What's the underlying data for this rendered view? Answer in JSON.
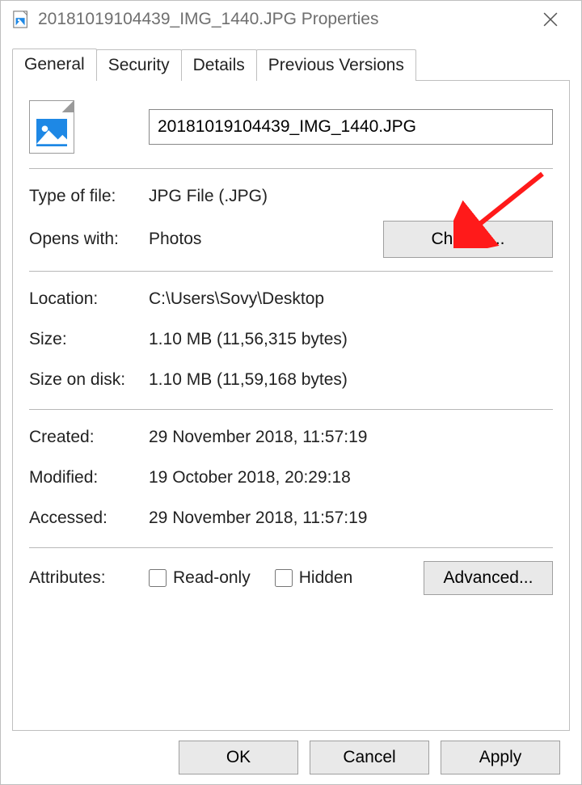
{
  "window": {
    "title": "20181019104439_IMG_1440.JPG Properties"
  },
  "tabs": {
    "general": "General",
    "security": "Security",
    "details": "Details",
    "previous_versions": "Previous Versions"
  },
  "file": {
    "name": "20181019104439_IMG_1440.JPG"
  },
  "fields": {
    "type_of_file_label": "Type of file:",
    "type_of_file_value": "JPG File (.JPG)",
    "opens_with_label": "Opens with:",
    "opens_with_value": "Photos",
    "change_button": "Change...",
    "location_label": "Location:",
    "location_value": "C:\\Users\\Sovy\\Desktop",
    "size_label": "Size:",
    "size_value": "1.10 MB (11,56,315 bytes)",
    "size_on_disk_label": "Size on disk:",
    "size_on_disk_value": "1.10 MB (11,59,168 bytes)",
    "created_label": "Created:",
    "created_value": "29 November 2018, 11:57:19",
    "modified_label": "Modified:",
    "modified_value": "19 October 2018, 20:29:18",
    "accessed_label": "Accessed:",
    "accessed_value": "29 November 2018, 11:57:19",
    "attributes_label": "Attributes:",
    "readonly_label": "Read-only",
    "hidden_label": "Hidden",
    "advanced_button": "Advanced..."
  },
  "buttons": {
    "ok": "OK",
    "cancel": "Cancel",
    "apply": "Apply"
  }
}
